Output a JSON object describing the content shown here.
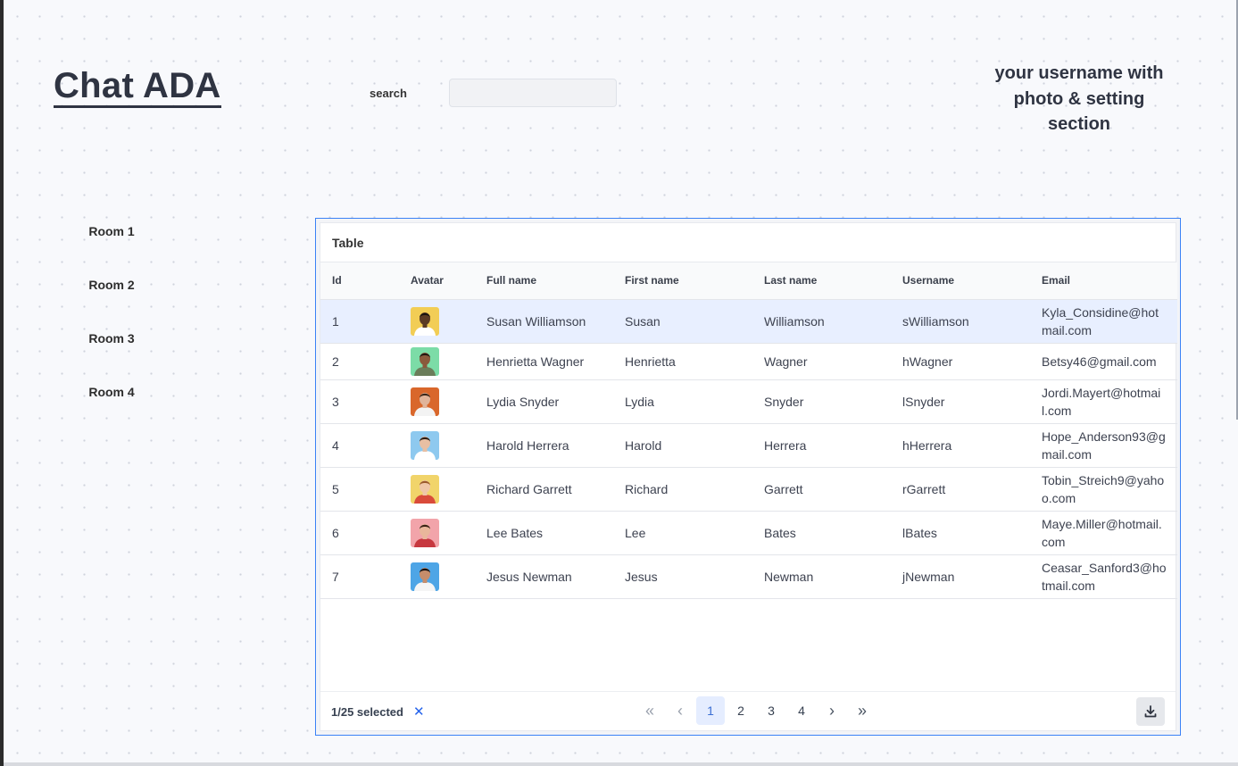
{
  "header": {
    "app_title": "Chat ADA",
    "search_label": "search",
    "search_value": "",
    "search_placeholder": "",
    "profile_section": "your username with photo & setting section"
  },
  "sidebar": {
    "rooms": [
      "Room 1",
      "Room 2",
      "Room 3",
      "Room 4"
    ]
  },
  "table": {
    "title": "Table",
    "columns": [
      "Id",
      "Avatar",
      "Full name",
      "First name",
      "Last name",
      "Username",
      "Email"
    ],
    "rows": [
      {
        "id": "1",
        "full_name": "Susan Williamson",
        "first_name": "Susan",
        "last_name": "Williamson",
        "username": "sWilliamson",
        "email": "Kyla_Considine@hotmail.com",
        "selected": true,
        "avatar_bg": "#f2cd55",
        "skin": "#5b3a24",
        "shirt": "#ffffff",
        "hair": "#1b1410"
      },
      {
        "id": "2",
        "full_name": "Henrietta Wagner",
        "first_name": "Henrietta",
        "last_name": "Wagner",
        "username": "hWagner",
        "email": "Betsy46@gmail.com",
        "selected": false,
        "avatar_bg": "#7cdca7",
        "skin": "#8a5a3c",
        "shirt": "#6b7d5a",
        "hair": "#231812"
      },
      {
        "id": "3",
        "full_name": "Lydia Snyder",
        "first_name": "Lydia",
        "last_name": "Snyder",
        "username": "lSnyder",
        "email": "Jordi.Mayert@hotmail.com",
        "selected": false,
        "avatar_bg": "#d9672b",
        "skin": "#e0b49a",
        "shirt": "#f3f3f3",
        "hair": "#3a2618"
      },
      {
        "id": "4",
        "full_name": "Harold Herrera",
        "first_name": "Harold",
        "last_name": "Herrera",
        "username": "hHerrera",
        "email": "Hope_Anderson93@gmail.com",
        "selected": false,
        "avatar_bg": "#8ec9ef",
        "skin": "#e8bfa3",
        "shirt": "#ffffff",
        "hair": "#2b1d15"
      },
      {
        "id": "5",
        "full_name": "Richard Garrett",
        "first_name": "Richard",
        "last_name": "Garrett",
        "username": "rGarrett",
        "email": "Tobin_Streich9@yahoo.com",
        "selected": false,
        "avatar_bg": "#f1d46a",
        "skin": "#efc6a8",
        "shirt": "#d94b3a",
        "hair": "#9b5a2c"
      },
      {
        "id": "6",
        "full_name": "Lee Bates",
        "first_name": "Lee",
        "last_name": "Bates",
        "username": "lBates",
        "email": "Maye.Miller@hotmail.com",
        "selected": false,
        "avatar_bg": "#f2a4aa",
        "skin": "#e9b79b",
        "shirt": "#c7383f",
        "hair": "#3b2417"
      },
      {
        "id": "7",
        "full_name": "Jesus Newman",
        "first_name": "Jesus",
        "last_name": "Newman",
        "username": "jNewman",
        "email": "Ceasar_Sanford3@hotmail.com",
        "selected": false,
        "avatar_bg": "#4ea5e6",
        "skin": "#c68d6b",
        "shirt": "#f5f5f5",
        "hair": "#141010"
      }
    ]
  },
  "footer": {
    "selection_text": "1/25 selected",
    "clear_icon": "close-icon",
    "pages": [
      "1",
      "2",
      "3",
      "4"
    ],
    "current_page": "1",
    "first_icon": "chevrons-left-icon",
    "prev_icon": "chevron-left-icon",
    "next_icon": "chevron-right-icon",
    "last_icon": "chevrons-right-icon",
    "download_icon": "download-icon"
  },
  "colors": {
    "accent": "#3b82f6",
    "selected_row": "#e8efff",
    "active_page": "#e5edff"
  }
}
